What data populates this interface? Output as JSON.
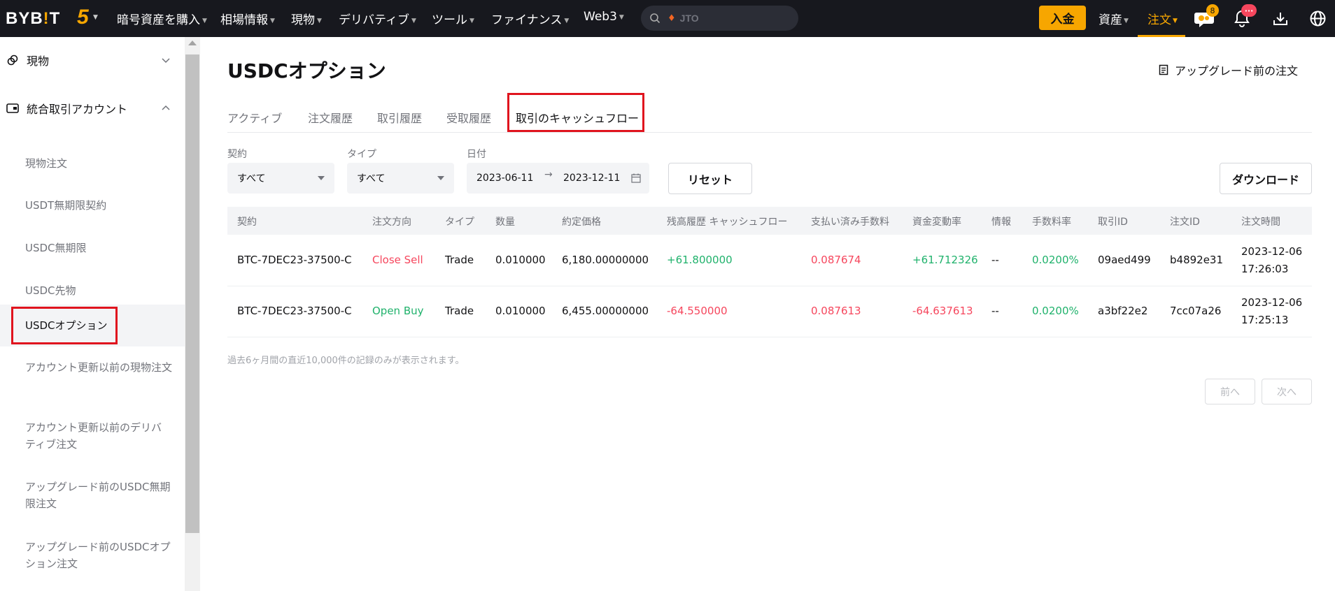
{
  "topnav": {
    "logo": "BYB",
    "logo_bang": "!",
    "logo_tail": "T",
    "five_label": "5",
    "items": [
      "暗号資産を購入",
      "相場情報",
      "現物",
      "デリバティブ",
      "ツール",
      "ファイナンス",
      "Web3"
    ],
    "search_placeholder": "JTO",
    "deposit": "入金",
    "assets": "資産",
    "orders": "注文",
    "chat_badge": "8",
    "notif_badge": "···",
    "accent_color": "#f7a600"
  },
  "sidebar": {
    "group_spot": "現物",
    "group_unified": "統合取引アカウント",
    "items": [
      "現物注文",
      "USDT無期限契約",
      "USDC無期限",
      "USDC先物",
      "USDCオプション",
      "アカウント更新以前の現物注文",
      "アカウント更新以前のデリバティブ注文",
      "アップグレード前のUSDC無期限注文",
      "アップグレード前のUSDCオプション注文"
    ],
    "active_index": 4
  },
  "main": {
    "title": "USDCオプション",
    "upgrade_link": "アップグレード前の注文",
    "tabs": [
      "アクティブ",
      "注文履歴",
      "取引履歴",
      "受取履歴",
      "取引のキャッシュフロー"
    ],
    "active_tab": 4,
    "filters": {
      "contract_label": "契約",
      "contract_value": "すべて",
      "type_label": "タイプ",
      "type_value": "すべて",
      "date_label": "日付",
      "date_from": "2023-06-11",
      "date_to": "2023-12-11",
      "date_sep": "→"
    },
    "reset_button": "リセット",
    "download_button": "ダウンロード",
    "table": {
      "headers": [
        "契約",
        "注文方向",
        "タイプ",
        "数量",
        "約定価格",
        "残高履歴 キャッシュフロー",
        "支払い済み手数料",
        "資金変動率",
        "情報",
        "手数料率",
        "取引ID",
        "注文ID",
        "注文時間"
      ],
      "rows": [
        {
          "contract": "BTC-7DEC23-37500-C",
          "side": "Close Sell",
          "type": "Trade",
          "qty": "0.010000",
          "price": "6,180.00000000",
          "cashflow": "+61.800000",
          "fee": "0.087674",
          "change": "+61.712326",
          "info": "--",
          "fee_rate": "0.0200%",
          "trade_id": "09aed499",
          "order_id": "b4892e31",
          "date": "2023-12-06",
          "time": "17:26:03"
        },
        {
          "contract": "BTC-7DEC23-37500-C",
          "side": "Open Buy",
          "type": "Trade",
          "qty": "0.010000",
          "price": "6,455.00000000",
          "cashflow": "-64.550000",
          "fee": "0.087613",
          "change": "-64.637613",
          "info": "--",
          "fee_rate": "0.0200%",
          "trade_id": "a3bf22e2",
          "order_id": "7cc07a26",
          "date": "2023-12-06",
          "time": "17:25:13"
        }
      ]
    },
    "note": "過去6ヶ月間の直近10,000件の記録のみが表示されます。",
    "prev_button": "前へ",
    "next_button": "次へ"
  }
}
